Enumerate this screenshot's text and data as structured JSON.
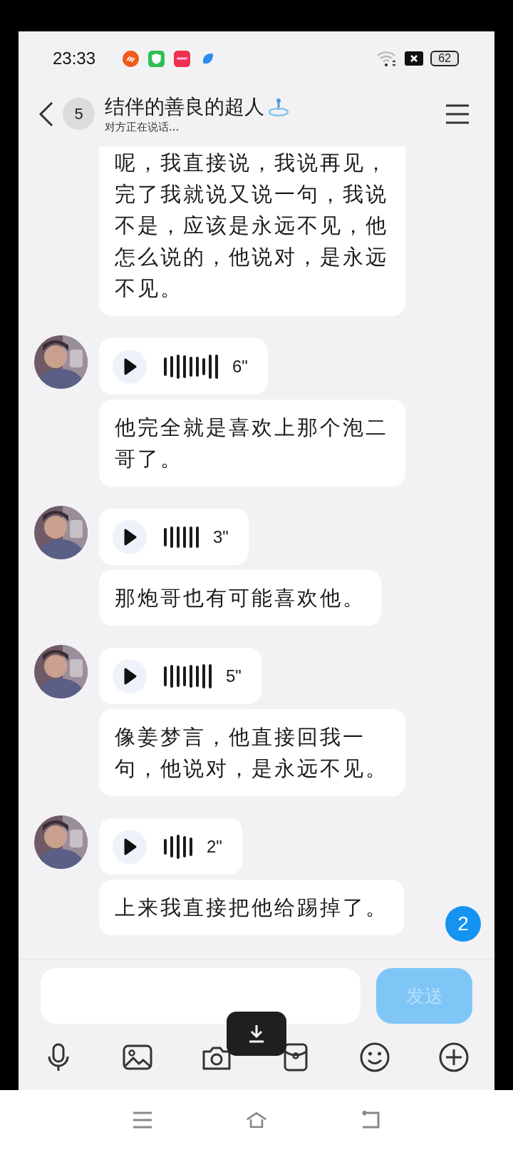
{
  "status_bar": {
    "time": "23:33",
    "battery": "62"
  },
  "header": {
    "unread": "5",
    "title": "结伴的善良的超人",
    "subtitle": "对方正在说话..."
  },
  "messages": [
    {
      "kind": "text",
      "text": "呢，我直接说，我说再见，完了我就说又说一句，我说不是，应该是永远不见，他怎么说的，他说对，是永远不见。"
    },
    {
      "kind": "voice",
      "duration": "6\""
    },
    {
      "kind": "text",
      "text": "他完全就是喜欢上那个泡二哥了。"
    },
    {
      "kind": "voice",
      "duration": "3\""
    },
    {
      "kind": "text",
      "text": "那炮哥也有可能喜欢他。"
    },
    {
      "kind": "voice",
      "duration": "5\""
    },
    {
      "kind": "text",
      "text": "像姜梦言，他直接回我一句，他说对，是永远不见。"
    },
    {
      "kind": "voice",
      "duration": "2\""
    },
    {
      "kind": "text",
      "text": "上来我直接把他给踢掉了。"
    }
  ],
  "new_messages_badge": "2",
  "composer": {
    "send_button": {
      "label": "发送",
      "disabled": true
    }
  }
}
